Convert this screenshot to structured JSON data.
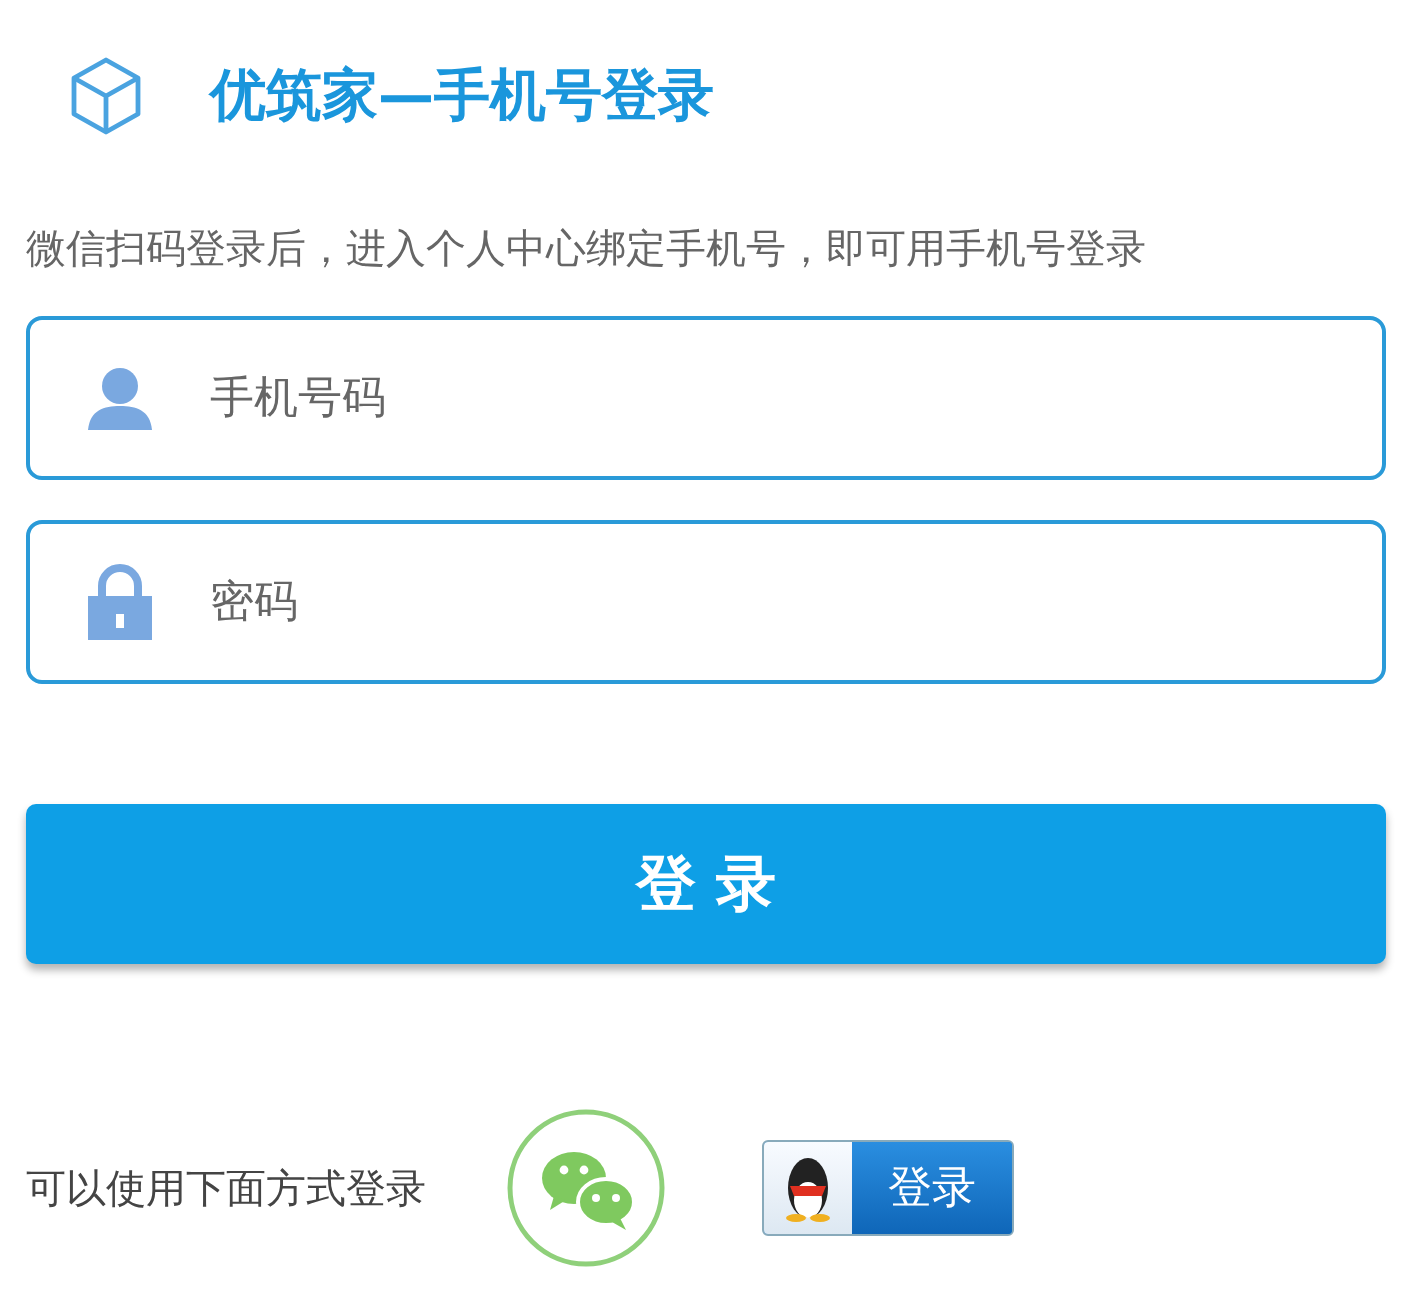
{
  "header": {
    "title": "优筑家—手机号登录"
  },
  "hint": "微信扫码登录后，进入个人中心绑定手机号，即可用手机号登录",
  "fields": [
    {
      "kind": "phone",
      "placeholder": "手机号码"
    },
    {
      "kind": "password",
      "placeholder": "密码"
    }
  ],
  "login_button": "登 录",
  "alt_login": {
    "label": "可以使用下面方式登录",
    "qq_button": "登录"
  }
}
